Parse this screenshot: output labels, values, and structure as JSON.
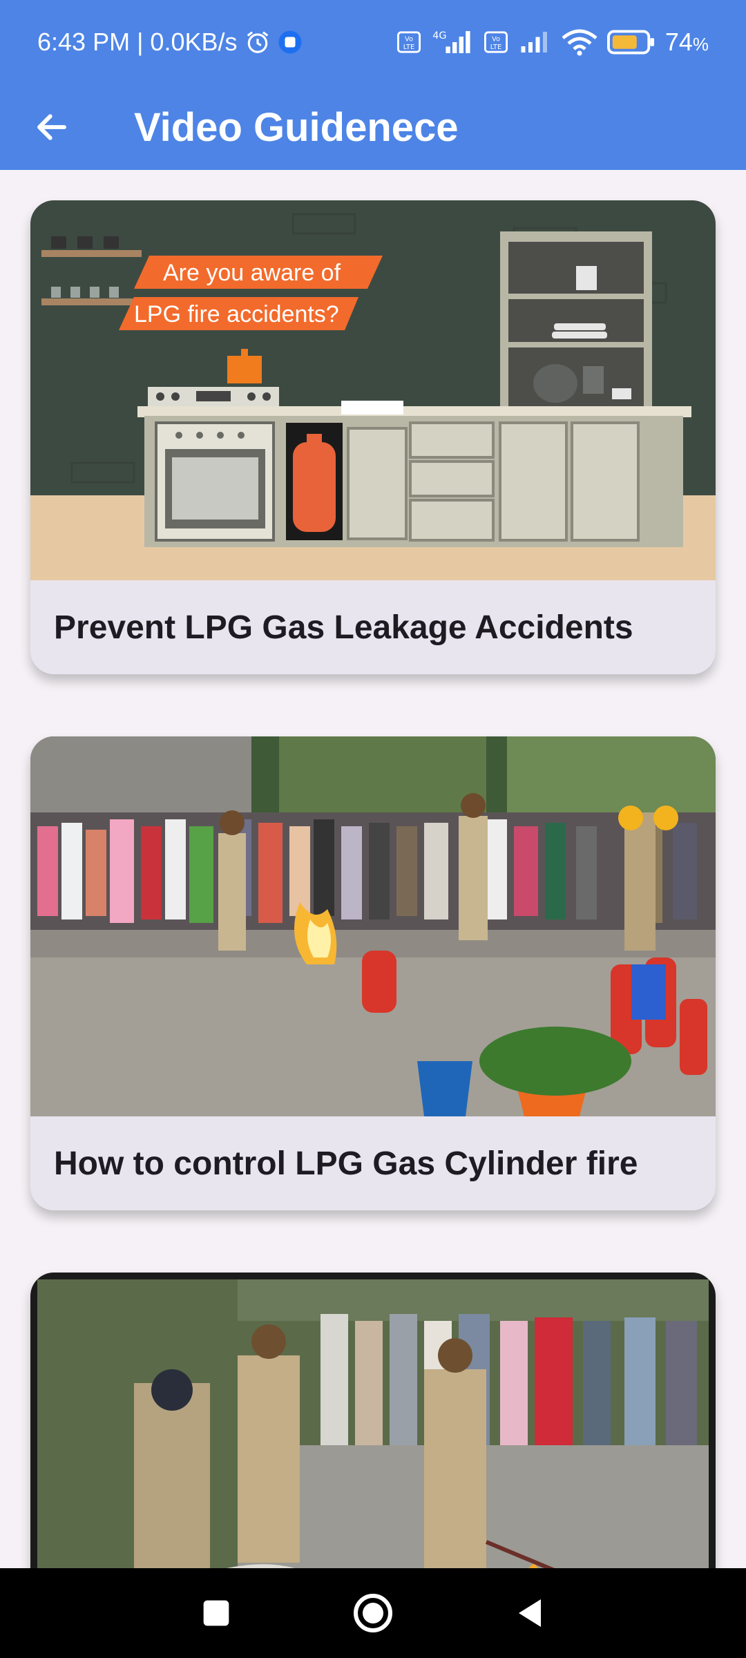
{
  "status_bar": {
    "time_speed": "6:43 PM | 0.0KB/s",
    "battery_percent": "74",
    "battery_unit": "%",
    "network_label": "4G",
    "volte_label": "Vo LTE"
  },
  "app_bar": {
    "title": "Video Guidenece"
  },
  "videos": [
    {
      "title": "Prevent LPG Gas Leakage Accidents",
      "thumb_banner_line1": "Are you aware of",
      "thumb_banner_line2": "LPG fire accidents?"
    },
    {
      "title": "How to control LPG Gas Cylinder fire"
    },
    {
      "title": ""
    }
  ],
  "colors": {
    "primary": "#4d84e6",
    "background": "#f5f1f6",
    "card": "#e9e5ef",
    "accent_orange": "#f26b2c"
  }
}
